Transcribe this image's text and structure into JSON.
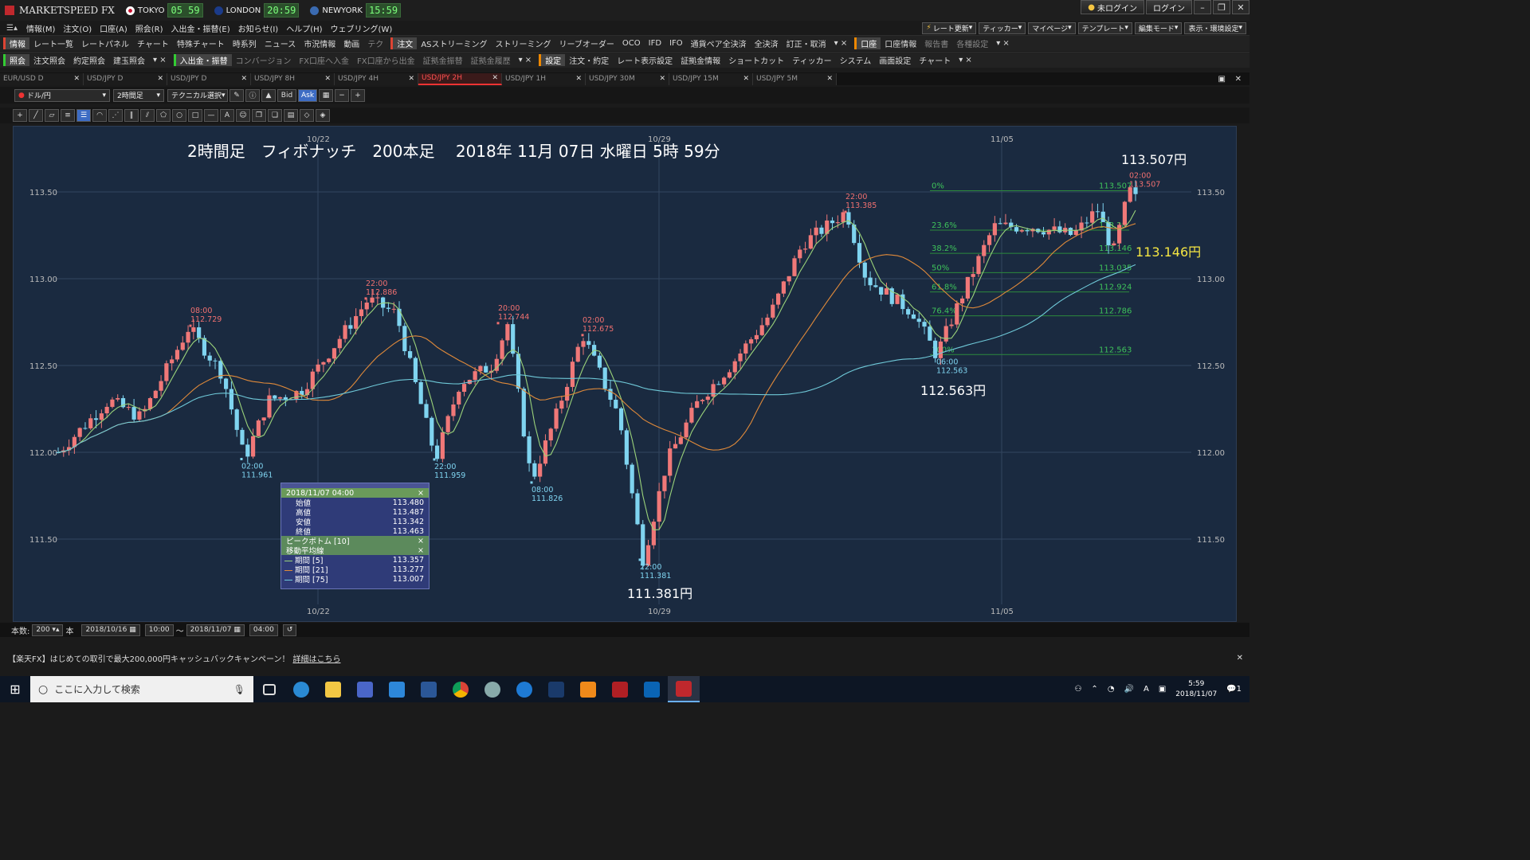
{
  "app": {
    "title": "MARKETSPEED FX",
    "markets": [
      {
        "city": "TOKYO",
        "time": "05 59",
        "color": "#c8102e"
      },
      {
        "city": "LONDON",
        "time": "20:59",
        "color": "#1b3b8a"
      },
      {
        "city": "NEWYORK",
        "time": "15:59",
        "color": "#3a6ab0"
      }
    ],
    "login_status": "未ログイン",
    "login_button": "ログイン",
    "win_minimize": "–",
    "win_restore": "❐",
    "win_close": "✕"
  },
  "menu": {
    "items": [
      "情報(M)",
      "注文(O)",
      "口座(A)",
      "照会(R)",
      "入出金・振替(E)",
      "お知らせ(I)",
      "ヘルプ(H)",
      "ウェブリング(W)"
    ],
    "right_buttons": [
      "レート更新",
      "ティッカー",
      "マイページ",
      "テンプレート",
      "編集モード",
      "表示・環境設定"
    ]
  },
  "toolbar1": {
    "head1": "情報",
    "items1": [
      "レート一覧",
      "レートパネル",
      "チャート",
      "特殊チャート",
      "時系列",
      "ニュース",
      "市況情報",
      "動画",
      "テク"
    ],
    "head2": "注文",
    "items2": [
      "ASストリーミング",
      "ストリーミング",
      "リーブオーダー",
      "OCO",
      "IFD",
      "IFO",
      "通貨ペア全決済",
      "全決済",
      "訂正・取消"
    ],
    "head3": "口座",
    "items3": [
      "口座情報",
      "報告書",
      "各種設定"
    ]
  },
  "toolbar2": {
    "head1": "照会",
    "items1": [
      "注文照会",
      "約定照会",
      "建玉照会"
    ],
    "head2": "入出金・振替",
    "items2": [
      "コンバージョン",
      "FX口座へ入金",
      "FX口座から出金",
      "証拠金振替",
      "証拠金履歴"
    ],
    "head3": "設定",
    "items3": [
      "注文・約定",
      "レート表示設定",
      "証拠金情報",
      "ショートカット",
      "ティッカー",
      "システム",
      "画面設定",
      "チャート"
    ]
  },
  "tabs": [
    {
      "label": "EUR/USD D",
      "active": false
    },
    {
      "label": "USD/JPY D",
      "active": false
    },
    {
      "label": "USD/JPY D",
      "active": false
    },
    {
      "label": "USD/JPY 8H",
      "active": false
    },
    {
      "label": "USD/JPY 4H",
      "active": false
    },
    {
      "label": "USD/JPY 2H",
      "active": true
    },
    {
      "label": "USD/JPY 1H",
      "active": false
    },
    {
      "label": "USD/JPY 30M",
      "active": false
    },
    {
      "label": "USD/JPY 15M",
      "active": false
    },
    {
      "label": "USD/JPY 5M",
      "active": false
    }
  ],
  "chart_tools": {
    "pair": "ドル/円",
    "timeframe": "2時間足",
    "technical": "テクニカル選択",
    "bid": "Bid",
    "ask": "Ask"
  },
  "chart_data": {
    "type": "candlestick",
    "title": "2時間足　フィボナッチ　200本足　 2018年 11月 07日 水曜日 5時 59分",
    "y_axis_ticks": [
      "113.50",
      "113.00",
      "112.50",
      "112.00",
      "111.50"
    ],
    "ylim": [
      111.3,
      113.6
    ],
    "x_axis_ticks": [
      "10/22",
      "10/29",
      "11/05"
    ],
    "bars": 200,
    "fibonacci": [
      {
        "level": "0%",
        "price": "113.507"
      },
      {
        "level": "23.6%",
        "price": "113.28"
      },
      {
        "level": "38.2%",
        "price": "113.146"
      },
      {
        "level": "50%",
        "price": "113.035"
      },
      {
        "level": "61.8%",
        "price": "112.924"
      },
      {
        "level": "76.4%",
        "price": "112.786"
      },
      {
        "level": "100%",
        "price": "112.563"
      }
    ],
    "peaks": [
      {
        "time": "08:00",
        "price": "112.729",
        "type": "high"
      },
      {
        "time": "22:00",
        "price": "112.886",
        "type": "high"
      },
      {
        "time": "20:00",
        "price": "112.744",
        "type": "high"
      },
      {
        "time": "02:00",
        "price": "112.675",
        "type": "high"
      },
      {
        "time": "22:00",
        "price": "113.385",
        "type": "high"
      },
      {
        "time": "02:00",
        "price": "113.507",
        "type": "high"
      },
      {
        "time": "02:00",
        "price": "111.961",
        "type": "low"
      },
      {
        "time": "22:00",
        "price": "111.959",
        "type": "low"
      },
      {
        "time": "08:00",
        "price": "111.826",
        "type": "low"
      },
      {
        "time": "22:00",
        "price": "111.381",
        "type": "low"
      },
      {
        "time": "06:00",
        "price": "112.563",
        "type": "low"
      }
    ],
    "annotations": [
      {
        "text": "113.507円",
        "color": "#ffffff"
      },
      {
        "text": "113.146円",
        "color": "#f5e642"
      },
      {
        "text": "112.563円",
        "color": "#ffffff"
      },
      {
        "text": "111.381円",
        "color": "#ffffff"
      }
    ],
    "moving_averages": [
      {
        "period": "期間 [5]",
        "value": "113.357",
        "color": "#9ad27a"
      },
      {
        "period": "期間 [21]",
        "value": "113.277",
        "color": "#e08a3a"
      },
      {
        "period": "期間 [75]",
        "value": "113.007",
        "color": "#6fc9d8"
      }
    ]
  },
  "infobox": {
    "datetime": "2018/11/07 04:00",
    "close_x": "×",
    "rows": [
      {
        "label": "始値",
        "value": "113.480"
      },
      {
        "label": "高値",
        "value": "113.487"
      },
      {
        "label": "安値",
        "value": "113.342"
      },
      {
        "label": "終値",
        "value": "113.463"
      }
    ],
    "peak_label": "ピークボトム [10]",
    "ma_label": "移動平均線"
  },
  "bottom": {
    "count_label": "本数:",
    "count_value": "200",
    "unit": "本",
    "date_from": "2018/10/16",
    "time_from": "10:00",
    "tilde": "～",
    "date_to": "2018/11/07",
    "time_to": "04:00"
  },
  "banner": {
    "text": "【楽天FX】はじめての取引で最大200,000円キャッシュバックキャンペーン！",
    "link": "詳細はこちら"
  },
  "taskbar": {
    "search_placeholder": "ここに入力して検索",
    "time": "5:59",
    "date": "2018/11/07",
    "ime": "A",
    "notif": "1"
  }
}
